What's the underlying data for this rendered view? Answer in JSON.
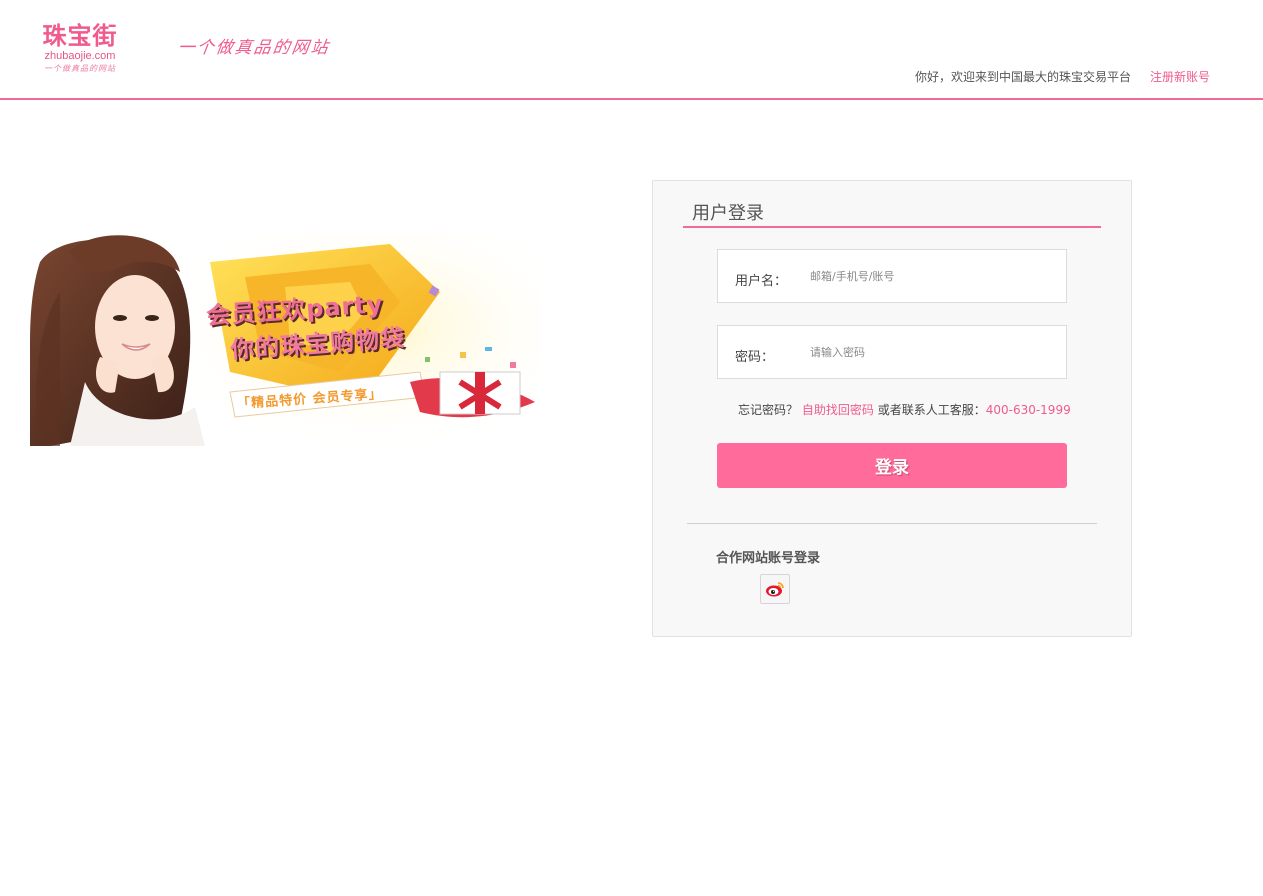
{
  "header": {
    "logo_name": "珠宝街",
    "logo_domain": "zhubaojie.com",
    "logo_slogan": "一个做真品的网站",
    "slogan": "一个做真品的网站",
    "welcome_text": "你好，欢迎来到中国最大的珠宝交易平台",
    "register_link": "注册新账号",
    "accent_color": "#f26b95"
  },
  "banner": {
    "line1": "会员狂欢party",
    "line2": "你的珠宝购物袋",
    "line3": "「精品特价 会员专享」"
  },
  "login": {
    "title": "用户登录",
    "username_label": "用户名：",
    "username_placeholder": "邮箱/手机号/账号",
    "password_label": "密码：",
    "password_placeholder": "请输入密码",
    "forgot_prefix": "忘记密码？",
    "forgot_link": "自助找回密码",
    "forgot_middle": "或者联系人工客服：",
    "hotline": "400-630-1999",
    "submit_label": "登录",
    "button_color": "#ff6b9b",
    "partner_title": "合作网站账号登录",
    "partner_icon": "weibo-icon"
  }
}
